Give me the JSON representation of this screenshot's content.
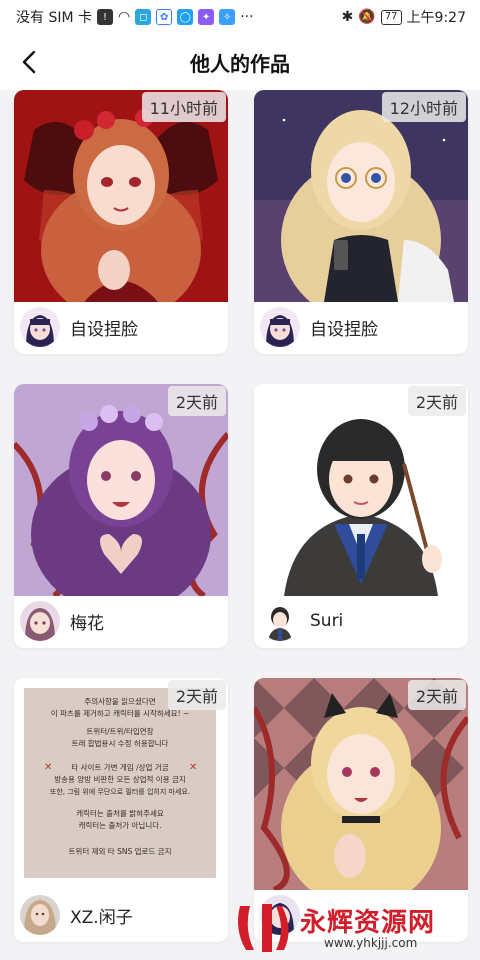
{
  "status_bar": {
    "carrier": "没有 SIM 卡",
    "battery": "77",
    "time": "上午9:27"
  },
  "header": {
    "title": "他人的作品",
    "back_icon": "back-arrow-icon"
  },
  "cards": [
    {
      "time": "11小时前",
      "user": "自设捏脸"
    },
    {
      "time": "12小时前",
      "user": "自设捏脸"
    },
    {
      "time": "2天前",
      "user": "梅花"
    },
    {
      "time": "2天前",
      "user": "Suri"
    },
    {
      "time": "2天前",
      "user": "XZ.闲子",
      "note": [
        "주의사항을 읽으셨다면",
        "이 파츠를 제거하고 캐릭터를 시작하세요! ~",
        "트위터/트위/타입연장",
        "트레 합법용시 수정 허용합니다",
        "타 사이트 가변 게임 /상업 거금",
        "방송용 양방 비판한 모든 상업적 이용 금지",
        "또한, 그림 위에 무단으로 필터를 입히지 마세요.",
        "캐릭터는 출처를 밝혀주세요",
        "캐릭터는 출처가 아닙니다.",
        "트위터 제외 타 SNS 업로드 금지"
      ]
    },
    {
      "time": "2天前",
      "user": ""
    }
  ],
  "watermark": {
    "brand": "永辉资源网",
    "url": "www.yhkjjj.com"
  },
  "colors": {
    "background": "#f3f3f5",
    "card": "#ffffff",
    "watermark_red": "#d21d2b"
  }
}
